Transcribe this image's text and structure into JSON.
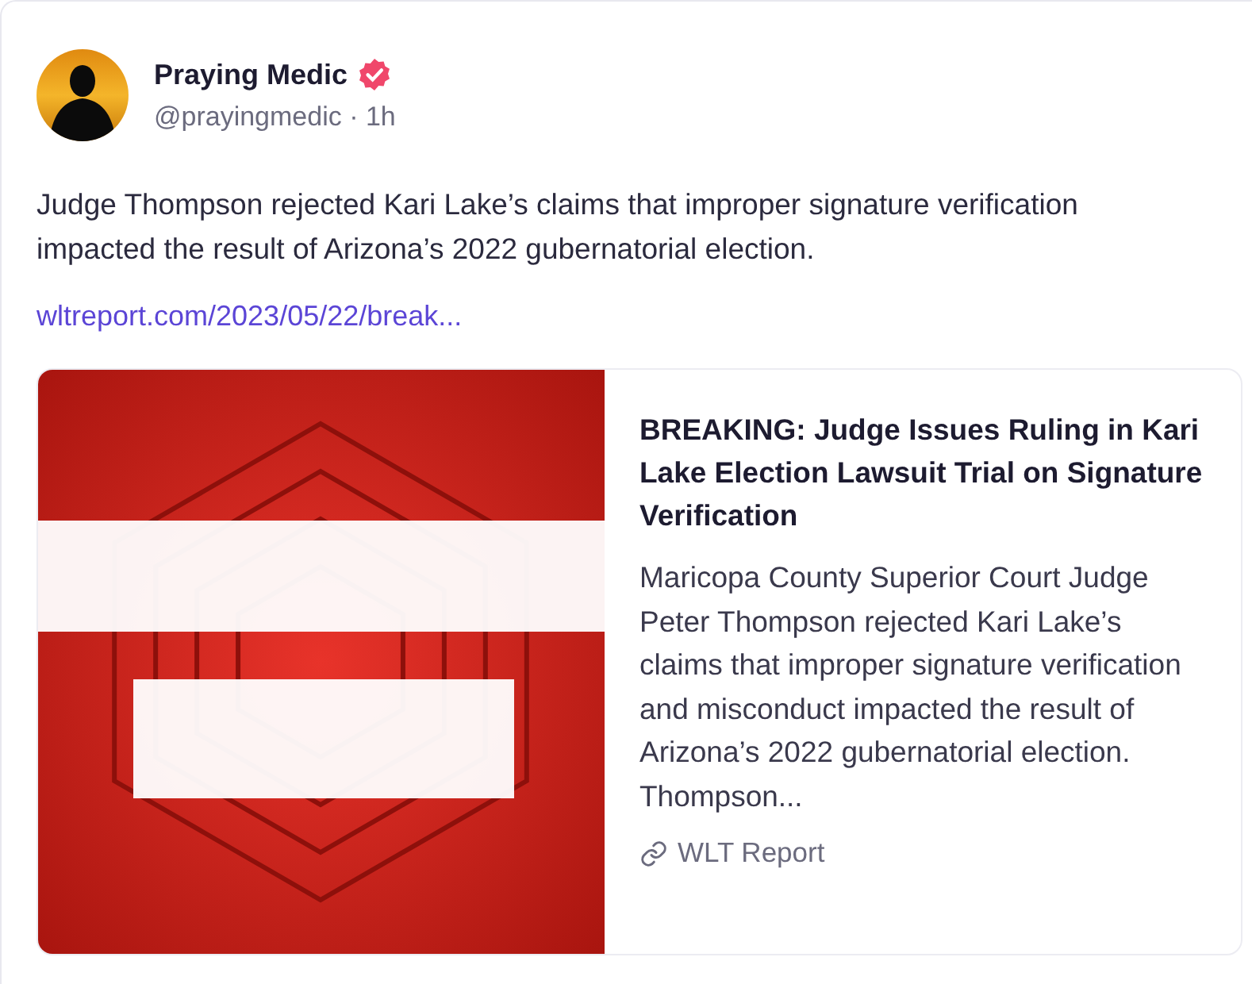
{
  "post": {
    "author": "Praying Medic",
    "verified": true,
    "handle": "@prayingmedic · 1h",
    "text": "Judge Thompson rejected Kari Lake’s claims that improper signature verification impacted the result of Arizona’s 2022 gubernatorial election.",
    "link": "wltreport.com/2023/05/22/break...",
    "preview": {
      "title": "BREAKING: Judge Issues Ruling in Kari Lake Election Lawsuit Trial on Signature Verification",
      "description": "Maricopa County Superior Court Judge Peter Thompson rejected Kari Lake’s claims that improper signature verification and misconduct impacted the result of Arizona’s 2022 gubernatorial election. Thompson...",
      "source": "WLT Report"
    }
  }
}
